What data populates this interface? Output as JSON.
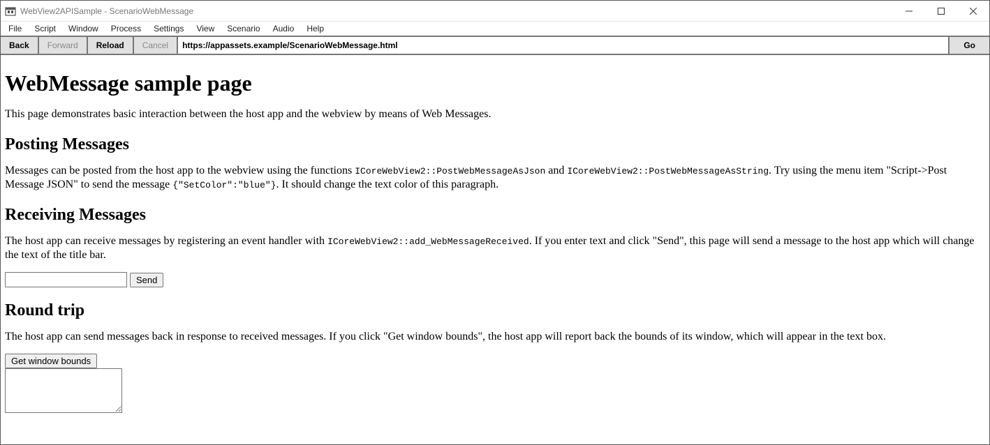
{
  "window": {
    "title": "WebView2APISample - ScenarioWebMessage"
  },
  "menubar": {
    "items": [
      "File",
      "Script",
      "Window",
      "Process",
      "Settings",
      "View",
      "Scenario",
      "Audio",
      "Help"
    ]
  },
  "toolbar": {
    "back": "Back",
    "forward": "Forward",
    "reload": "Reload",
    "cancel": "Cancel",
    "address": "https://appassets.example/ScenarioWebMessage.html",
    "go": "Go"
  },
  "page": {
    "h1": "WebMessage sample page",
    "intro": "This page demonstrates basic interaction between the host app and the webview by means of Web Messages.",
    "posting": {
      "heading": "Posting Messages",
      "p_a": "Messages can be posted from the host app to the webview using the functions ",
      "code1": "ICoreWebView2::PostWebMessageAsJson",
      "p_b": " and ",
      "code2": "ICoreWebView2::PostWebMessageAsString",
      "p_c": ". Try using the menu item \"Script->Post Message JSON\" to send the message ",
      "code3": "{\"SetColor\":\"blue\"}",
      "p_d": ". It should change the text color of this paragraph."
    },
    "receiving": {
      "heading": "Receiving Messages",
      "p_a": "The host app can receive messages by registering an event handler with ",
      "code1": "ICoreWebView2::add_WebMessageReceived",
      "p_b": ". If you enter text and click \"Send\", this page will send a message to the host app which will change the text of the title bar.",
      "send_label": "Send"
    },
    "roundtrip": {
      "heading": "Round trip",
      "p": "The host app can send messages back in response to received messages. If you click \"Get window bounds\", the host app will report back the bounds of its window, which will appear in the text box.",
      "button": "Get window bounds"
    }
  }
}
